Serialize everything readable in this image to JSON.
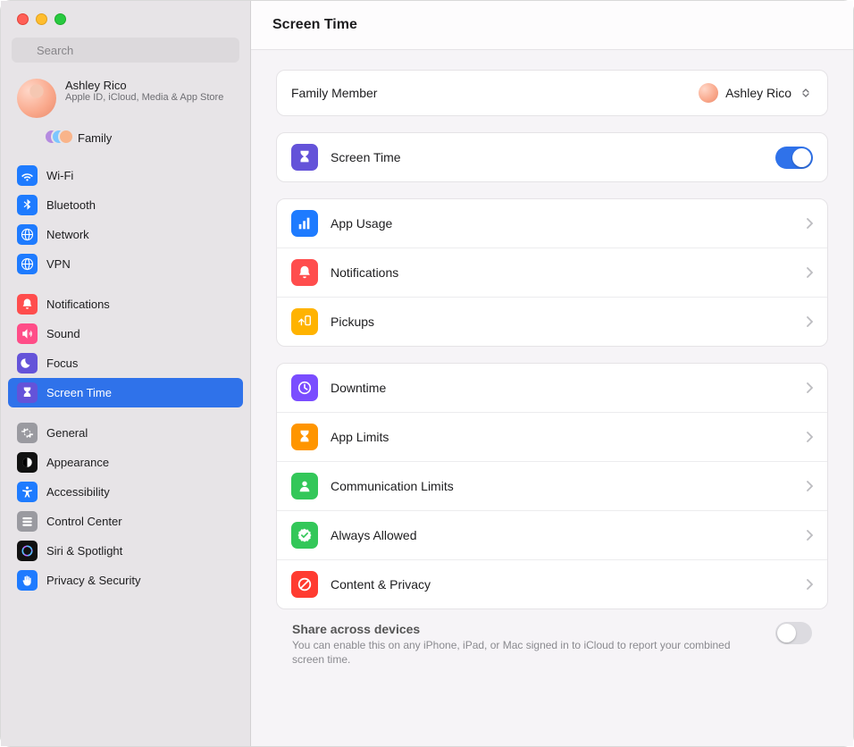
{
  "window": {
    "title": "Screen Time"
  },
  "search": {
    "placeholder": "Search"
  },
  "account": {
    "name": "Ashley Rico",
    "subtitle": "Apple ID, iCloud, Media & App Store"
  },
  "family_label": "Family",
  "sidebar": [
    {
      "label": "Wi-Fi",
      "icon": "wifi",
      "bg": "#1e7bff"
    },
    {
      "label": "Bluetooth",
      "icon": "bluetooth",
      "bg": "#1e7bff"
    },
    {
      "label": "Network",
      "icon": "network",
      "bg": "#1e7bff"
    },
    {
      "label": "VPN",
      "icon": "vpn",
      "bg": "#1e7bff"
    }
  ],
  "sidebar2": [
    {
      "label": "Notifications",
      "icon": "bell",
      "bg": "#ff4d4d"
    },
    {
      "label": "Sound",
      "icon": "sound",
      "bg": "#ff4d88"
    },
    {
      "label": "Focus",
      "icon": "moon",
      "bg": "#6453d9"
    },
    {
      "label": "Screen Time",
      "icon": "hourglass",
      "bg": "#6453d9",
      "selected": true
    }
  ],
  "sidebar3": [
    {
      "label": "General",
      "icon": "gear",
      "bg": "#9a9aa0"
    },
    {
      "label": "Appearance",
      "icon": "appearance",
      "bg": "#111111"
    },
    {
      "label": "Accessibility",
      "icon": "accessibility",
      "bg": "#1e7bff"
    },
    {
      "label": "Control Center",
      "icon": "sliders",
      "bg": "#9a9aa0"
    },
    {
      "label": "Siri & Spotlight",
      "icon": "siri",
      "bg": "#111111"
    },
    {
      "label": "Privacy & Security",
      "icon": "hand",
      "bg": "#1e7bff"
    }
  ],
  "family_member": {
    "label": "Family Member",
    "value": "Ashley Rico"
  },
  "screen_time_row": {
    "label": "Screen Time",
    "on": true
  },
  "sections": [
    [
      {
        "label": "App Usage",
        "icon": "chart",
        "bg": "#1e7bff"
      },
      {
        "label": "Notifications",
        "icon": "bell",
        "bg": "#ff4d4d"
      },
      {
        "label": "Pickups",
        "icon": "pickups",
        "bg": "#ffb300"
      }
    ],
    [
      {
        "label": "Downtime",
        "icon": "clock",
        "bg": "#7a4dff"
      },
      {
        "label": "App Limits",
        "icon": "hourglass",
        "bg": "#ff9500"
      },
      {
        "label": "Communication Limits",
        "icon": "person",
        "bg": "#33c759"
      },
      {
        "label": "Always Allowed",
        "icon": "check",
        "bg": "#33c759"
      },
      {
        "label": "Content & Privacy",
        "icon": "nosign",
        "bg": "#ff3b30"
      }
    ]
  ],
  "share": {
    "title": "Share across devices",
    "desc": "You can enable this on any iPhone, iPad, or Mac signed in to iCloud to report your combined screen time.",
    "on": false
  }
}
